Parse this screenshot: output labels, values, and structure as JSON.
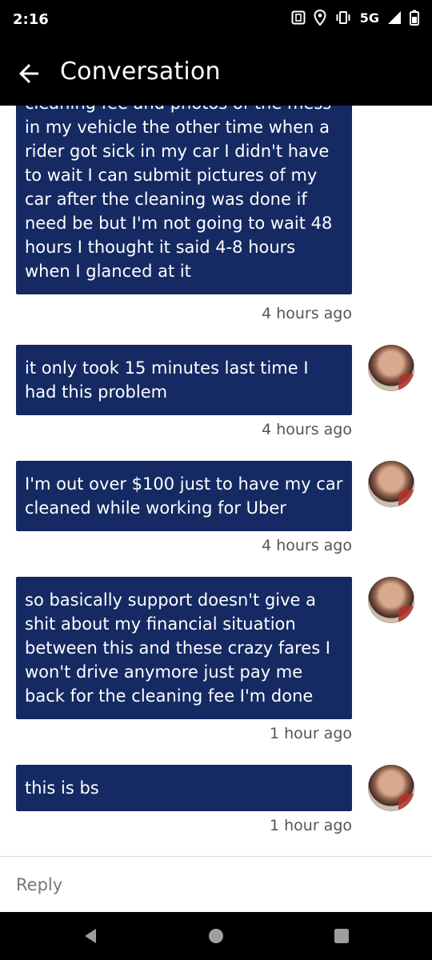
{
  "status_bar": {
    "time": "2:16",
    "network": "5G",
    "icons": [
      "nfc-icon",
      "location-icon",
      "vibrate-icon",
      "signal-icon",
      "battery-icon"
    ]
  },
  "app_bar": {
    "title": "Conversation",
    "back_icon": "arrow-back-icon"
  },
  "messages": [
    {
      "text": "cleaning fee and photos of the mess in my vehicle the other time when a rider got sick in my car I didn't have to wait I can submit pictures of my car after the cleaning was done if need be but I'm not going to wait 48 hours I thought it said 4-8 hours when I glanced at it",
      "time": "4 hours ago"
    },
    {
      "text": "it only took 15 minutes last time I had this problem",
      "time": "4 hours ago"
    },
    {
      "text": "I'm out over $100 just to have my car cleaned while working for Uber",
      "time": "4 hours ago"
    },
    {
      "text": "so basically support doesn't give a shit about my financial situation between this and these crazy fares I won't drive anymore just pay me back for the cleaning fee I'm done",
      "time": "1 hour ago"
    },
    {
      "text": "this is bs",
      "time": "1 hour ago"
    }
  ],
  "reply": {
    "placeholder": "Reply",
    "value": ""
  },
  "nav_bar": {
    "buttons": [
      "back-triangle-icon",
      "home-circle-icon",
      "recents-square-icon"
    ]
  },
  "colors": {
    "bubble": "#152a63",
    "bubble_text": "#ffffff",
    "header": "#000000",
    "timestamp": "#555555"
  }
}
